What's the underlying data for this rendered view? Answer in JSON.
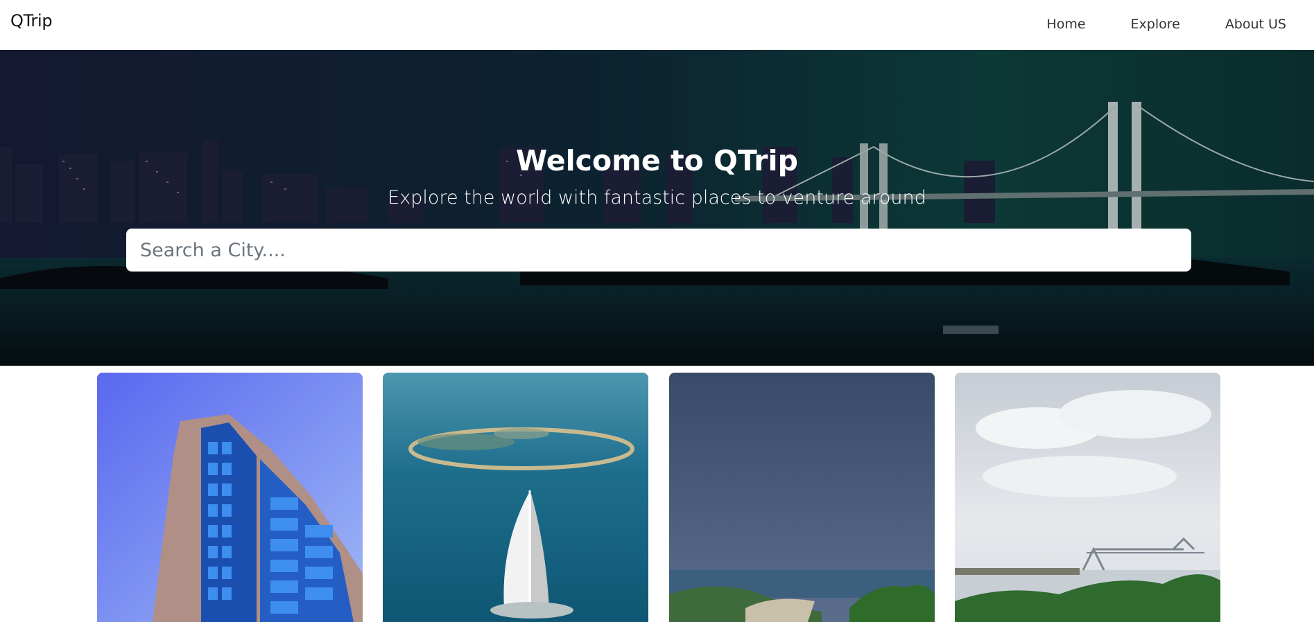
{
  "navbar": {
    "brand": "QTrip",
    "links": [
      {
        "label": "Home"
      },
      {
        "label": "Explore"
      },
      {
        "label": "About US"
      }
    ]
  },
  "hero": {
    "title": "Welcome to QTrip",
    "subtitle": "Explore the world with fantastic places to venture around",
    "search_placeholder": "Search a City...."
  },
  "colors": {
    "hero_bg_left": "#0c1626",
    "hero_bg_right": "#0d3a3a",
    "white": "#ffffff"
  },
  "cards": [
    {
      "image": "city-tower-image"
    },
    {
      "image": "dubai-burj-al-arab-image"
    },
    {
      "image": "coastline-image"
    },
    {
      "image": "river-bridge-image"
    }
  ]
}
